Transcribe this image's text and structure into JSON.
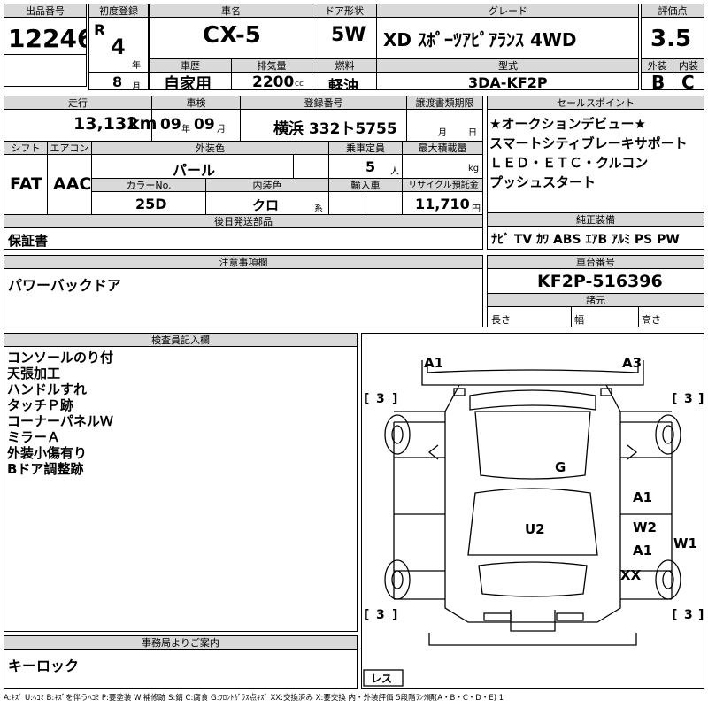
{
  "top": {
    "lot_label": "出品番号",
    "lot_value": "12246",
    "first_reg_label": "初度登録",
    "era": "R",
    "year_num": "4",
    "year_suffix": "年",
    "month_num": "8",
    "month_suffix": "月",
    "model_label": "車名",
    "model_value": "CX-5",
    "door_label": "ドア形状",
    "door_value": "5W",
    "grade_label": "グレード",
    "grade_value": "XD ｽﾎﾟｰﾂｱﾋﾟｱﾗﾝｽ 4WD",
    "score_label": "評価点",
    "score_value": "3.5",
    "history_label": "車歴",
    "history_value": "自家用",
    "disp_label": "排気量",
    "disp_value": "2200",
    "disp_unit": "cc",
    "fuel_label": "燃料",
    "fuel_value": "軽油",
    "type_label": "型式",
    "type_value": "3DA-KF2P",
    "ext_label": "外装",
    "ext_value": "B",
    "int_label": "内装",
    "int_value": "C"
  },
  "mid": {
    "mileage_label": "走行",
    "mileage_value": "13,132",
    "mileage_unit": "km",
    "inspection_label": "車検",
    "insp_year": "09",
    "insp_year_suffix": "年",
    "insp_month": "09",
    "insp_month_suffix": "月",
    "reg_label": "登録番号",
    "reg_value": "横浜 332ト5755",
    "transfer_label": "譲渡書類期限",
    "transfer_month": "月",
    "transfer_day": "日",
    "shift_label": "シフト",
    "shift_value": "FAT",
    "ac_label": "エアコン",
    "ac_value": "AAC",
    "ext_color_label": "外装色",
    "ext_color_value": "パール",
    "capacity_label": "乗車定員",
    "capacity_value": "5",
    "capacity_unit": "人",
    "load_label": "最大積載量",
    "load_unit": "kg",
    "color_no_label": "カラーNo.",
    "color_no_value": "25D",
    "int_color_label": "内装色",
    "int_color_value": "クロ",
    "int_color_suffix": "系",
    "import_label": "輸入車",
    "recycle_label": "リサイクル預託金",
    "recycle_value": "11,710",
    "recycle_unit": "円",
    "deferred_label": "後日発送部品",
    "deferred_value": "保証書"
  },
  "sales": {
    "label": "セールスポイント",
    "lines": [
      "★オークションデビュー★",
      "スマートシティブレーキサポート",
      "ＬＥＤ・ＥＴＣ・クルコン",
      "プッシュスタート"
    ]
  },
  "equipment": {
    "label": "純正装備",
    "value": "ﾅﾋﾞ TV ｶﾜ ABS ｴｱB ｱﾙﾐ PS PW"
  },
  "caution": {
    "label": "注意事項欄",
    "value": "パワーバックドア"
  },
  "chassis": {
    "label": "車台番号",
    "value": "KF2P-516396",
    "specs_label": "諸元",
    "length_label": "長さ",
    "width_label": "幅",
    "height_label": "高さ"
  },
  "inspector": {
    "label": "検査員記入欄",
    "lines": [
      "コンソールのり付",
      "天張加工",
      "ハンドルすれ",
      "タッチＰ跡",
      "コーナーパネルＷ",
      "ミラーＡ",
      "外装小傷有り",
      "Bドア調整跡"
    ]
  },
  "office": {
    "label": "事務局よりご案内",
    "value": "キーロック"
  },
  "diagram": {
    "marks": [
      "A1",
      "A3",
      "G",
      "A1",
      "W2",
      "A1",
      "W1",
      "U2",
      "XX"
    ],
    "tires": [
      "3",
      "3",
      "3",
      "3"
    ],
    "spare": "レス"
  },
  "legend": "A:ｷｽﾞ U:ﾍｺﾐ B:ｷｽﾞを伴うﾍｺﾐ P:要塗装 W:補修跡 S:錆 C:腐食 G:ﾌﾛﾝﾄｶﾞﾗｽ点ｷｽﾞ XX:交換済み X:要交換  内・外装評価 5段階ﾗﾝｸ順(A・B・C・D・E) 1"
}
